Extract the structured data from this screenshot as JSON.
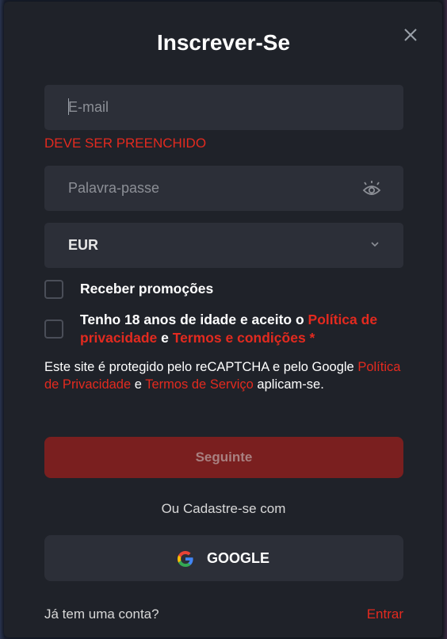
{
  "modal": {
    "title": "Inscrever-Se"
  },
  "email": {
    "placeholder": "E-mail",
    "value": "",
    "error": "DEVE SER PREENCHIDO"
  },
  "password": {
    "placeholder": "Palavra-passe",
    "value": ""
  },
  "currency": {
    "selected": "EUR"
  },
  "promotions": {
    "label": "Receber promoções",
    "checked": false
  },
  "terms": {
    "prefix": "Tenho 18 anos de idade e aceito o ",
    "privacy_link": "Política de privacidade",
    "connector": " e ",
    "terms_link": "Termos e condições",
    "required_mark": " *",
    "checked": false
  },
  "recaptcha": {
    "text_1": "Este site é protegido pelo reCAPTCHA e pelo Google ",
    "privacy_link": "Política de Privacidade",
    "connector": " e ",
    "terms_link": "Termos de Serviço",
    "text_2": " aplicam-se."
  },
  "buttons": {
    "next_label": "Seguinte",
    "or_text": "Ou Cadastre-se com",
    "google_label": "GOOGLE"
  },
  "footer": {
    "have_account": "Já tem uma conta?",
    "login_link": "Entrar"
  },
  "colors": {
    "accent": "#e32a1f",
    "button_disabled": "#7a1f1f",
    "panel": "#1f2229",
    "field": "#2c2f38"
  },
  "icons": [
    "close-icon",
    "eye-icon",
    "chevron-down-icon",
    "google-icon"
  ]
}
